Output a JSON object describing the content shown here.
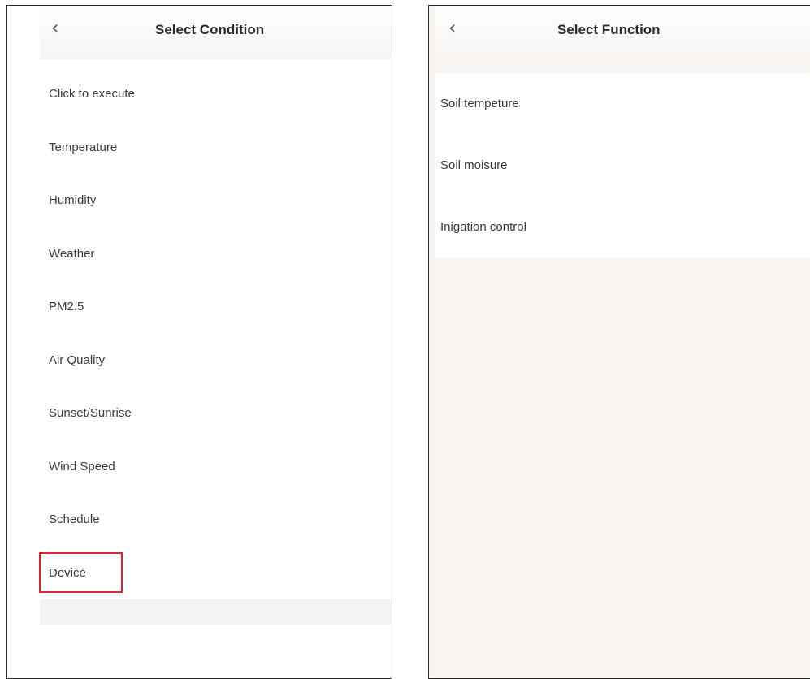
{
  "left_screen": {
    "title": "Select Condition",
    "back_symbol": "‹",
    "items": [
      {
        "label": "Click to execute"
      },
      {
        "label": "Temperature"
      },
      {
        "label": "Humidity"
      },
      {
        "label": "Weather"
      },
      {
        "label": "PM2.5"
      },
      {
        "label": "Air Quality"
      },
      {
        "label": "Sunset/Sunrise"
      },
      {
        "label": "Wind Speed"
      },
      {
        "label": "Schedule"
      },
      {
        "label": "Device"
      }
    ]
  },
  "right_screen": {
    "title": "Select Function",
    "back_symbol": "‹",
    "items": [
      {
        "label": "Soil tempeture"
      },
      {
        "label": "Soil moisure"
      },
      {
        "label": "Inigation control"
      }
    ]
  },
  "highlight": {
    "target": "Device",
    "color": "#e0242b"
  },
  "colors": {
    "text": "#3a3a3a",
    "title": "#2b2b2b",
    "panel_border": "#2a2a2a"
  }
}
